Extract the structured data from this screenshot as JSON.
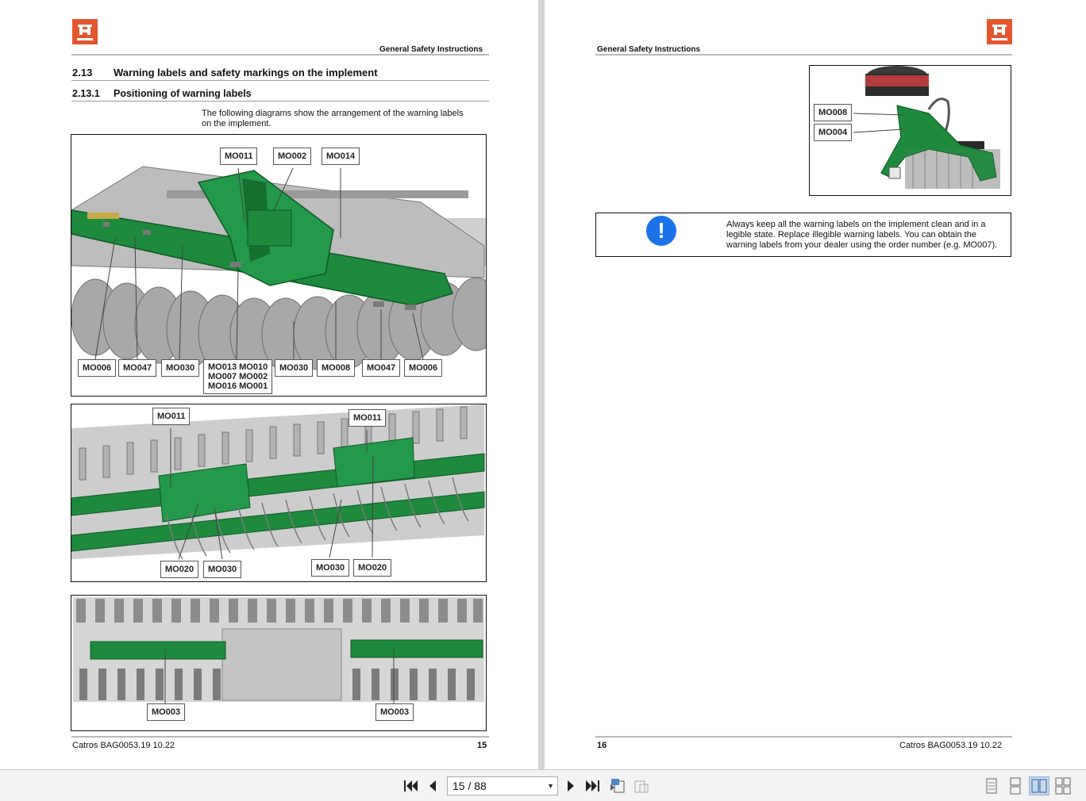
{
  "left_page": {
    "header": "General Safety Instructions",
    "section": {
      "number": "2.13",
      "title": "Warning labels and safety markings on the implement"
    },
    "subsection": {
      "number": "2.13.1",
      "title": "Positioning of warning labels"
    },
    "intro": [
      "The following diagrams show the arrangement of the warning labels",
      "on the implement."
    ],
    "figure1": {
      "top_labels": [
        "MO011",
        "MO002",
        "MO014"
      ],
      "bottom_labels": [
        "MO006",
        "MO047",
        "MO030",
        "MO030",
        "MO008",
        "MO047",
        "MO006"
      ],
      "multi_label": [
        "MO013 MO010",
        "MO007 MO002",
        "MO016 MO001"
      ]
    },
    "figure2": {
      "top_labels": [
        "MO011",
        "MO011"
      ],
      "bottom_labels": [
        "MO020",
        "MO030",
        "MO030",
        "MO020"
      ]
    },
    "figure3": {
      "bottom_labels": [
        "MO003",
        "MO003"
      ]
    },
    "footer": {
      "doc": "Catros  BAG0053.19  10.22",
      "page": "15"
    }
  },
  "right_page": {
    "header": "General Safety Instructions",
    "figure": {
      "labels": [
        "MO008",
        "MO004"
      ]
    },
    "notice": {
      "icon": "info-exclamation-icon",
      "lines": [
        "Always keep all the warning labels on the implement clean and in a",
        "legible state. Replace illegible warning labels. You can obtain the",
        "warning labels from your dealer using the order number (e.g. MO007)."
      ]
    },
    "footer": {
      "page": "16",
      "doc": "Catros  BAG0053.19  10.22"
    }
  },
  "toolbar": {
    "page_indicator": "15 / 88",
    "buttons": [
      "first-page-icon",
      "previous-page-icon",
      "next-page-icon",
      "last-page-icon",
      "previous-view-icon",
      "next-view-icon",
      "single-page-view-icon",
      "continuous-view-icon",
      "two-page-view-icon",
      "two-page-continuous-view-icon"
    ]
  },
  "colors": {
    "brand": "#e4572e",
    "implement_green": "#1e8a3c",
    "info_blue": "#1a73e8"
  }
}
